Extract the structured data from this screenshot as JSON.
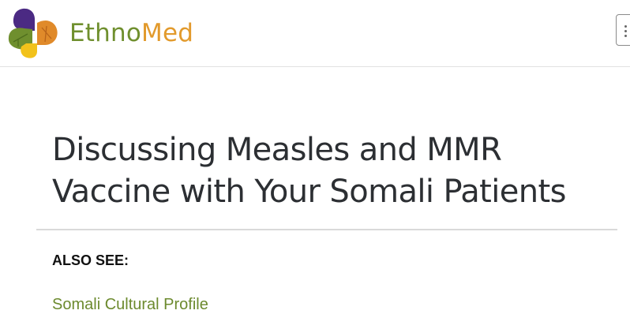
{
  "header": {
    "logo_text_part1": "Ethno",
    "logo_text_part2": "Med",
    "menu_button_icon": "menu-icon"
  },
  "article": {
    "title": "Discussing Measles and MMR Vaccine with Your Somali Patients"
  },
  "also_see": {
    "heading": "ALSO SEE:",
    "links": [
      {
        "label": "Somali Cultural Profile"
      }
    ]
  },
  "colors": {
    "brand_green": "#6f8f2e",
    "brand_orange": "#e29a2c",
    "brand_purple": "#4b2a83",
    "brand_yellow": "#f2c21b",
    "title_text": "#2c2f33",
    "link_green": "#6c8a2e"
  }
}
